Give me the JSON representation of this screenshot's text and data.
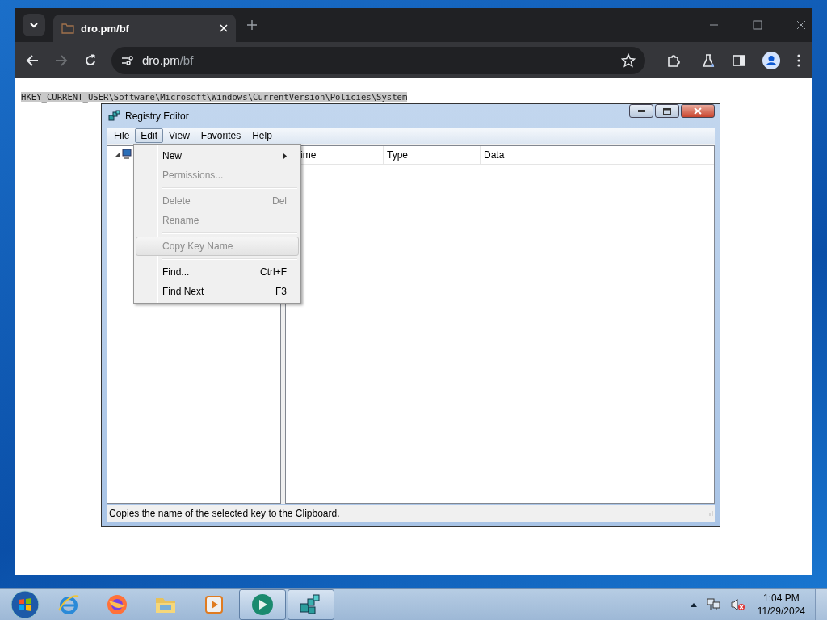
{
  "browser": {
    "tabs": [
      {
        "title": "dro.pm/bf",
        "selected": true
      }
    ],
    "address": {
      "host": "dro.pm",
      "path": "/bf"
    },
    "back_disabled": false,
    "forward_disabled": true
  },
  "page": {
    "selected_text": "HKEY_CURRENT_USER\\Software\\Microsoft\\Windows\\CurrentVersion\\Policies\\System"
  },
  "regedit": {
    "title": "Registry Editor",
    "menu_bar": [
      {
        "label": "File",
        "selected": false
      },
      {
        "label": "Edit",
        "selected": true
      },
      {
        "label": "View",
        "selected": false
      },
      {
        "label": "Favorites",
        "selected": false
      },
      {
        "label": "Help",
        "selected": false
      }
    ],
    "columns": [
      "ime",
      "Type",
      "Data"
    ],
    "edit_menu": [
      {
        "kind": "item",
        "label": "New",
        "submenu": true,
        "disabled": false,
        "highlighted": false
      },
      {
        "kind": "item",
        "label": "Permissions...",
        "disabled": true,
        "highlighted": false
      },
      {
        "kind": "separator"
      },
      {
        "kind": "item",
        "label": "Delete",
        "shortcut": "Del",
        "disabled": true,
        "highlighted": false
      },
      {
        "kind": "item",
        "label": "Rename",
        "disabled": true,
        "highlighted": false
      },
      {
        "kind": "separator"
      },
      {
        "kind": "item",
        "label": "Copy Key Name",
        "disabled": true,
        "highlighted": true
      },
      {
        "kind": "separator"
      },
      {
        "kind": "item",
        "label": "Find...",
        "shortcut": "Ctrl+F",
        "disabled": false,
        "highlighted": false
      },
      {
        "kind": "item",
        "label": "Find Next",
        "shortcut": "F3",
        "disabled": false,
        "highlighted": false
      }
    ],
    "status_bar": "Copies the name of the selected key to the Clipboard."
  },
  "taskbar": {
    "apps": [
      {
        "kind": "ie",
        "selected": false
      },
      {
        "kind": "firefox",
        "selected": false
      },
      {
        "kind": "folder",
        "selected": false
      },
      {
        "kind": "media",
        "selected": false
      },
      {
        "kind": "app",
        "selected": true
      },
      {
        "kind": "regedit",
        "selected": true
      }
    ],
    "time": "1:04 PM",
    "date": "11/29/2024"
  }
}
